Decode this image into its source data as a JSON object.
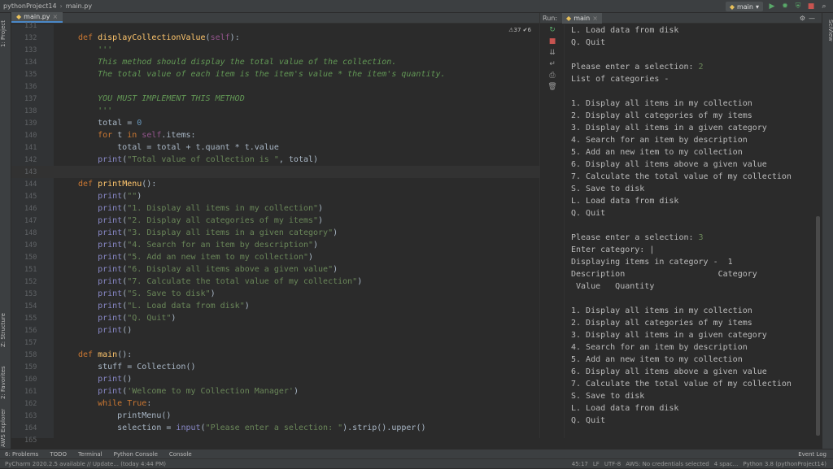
{
  "titlebar": {
    "project": "pythonProject14",
    "file": "main.py",
    "run_config": "main"
  },
  "editor": {
    "tab": "main.py",
    "inspection": "⚠37 ✔6",
    "lines": [
      {
        "n": "131",
        "html": ""
      },
      {
        "n": "132",
        "html": "<span class='kw'>def </span><span class='fn'>displayCollectionValue</span>(<span class='self'>self</span>):"
      },
      {
        "n": "133",
        "html": "    <span class='doc'>'''</span>"
      },
      {
        "n": "134",
        "html": "    <span class='doc'>This method should display the total value of the collection.</span>"
      },
      {
        "n": "135",
        "html": "    <span class='doc'>The total value of each item is the item's value * the item's quantity.</span>"
      },
      {
        "n": "136",
        "html": ""
      },
      {
        "n": "137",
        "html": "    <span class='doc'>YOU MUST IMPLEMENT THIS METHOD</span>"
      },
      {
        "n": "138",
        "html": "    <span class='doc'>'''</span>"
      },
      {
        "n": "139",
        "html": "    total = <span class='num'>0</span>"
      },
      {
        "n": "140",
        "html": "    <span class='kw'>for </span>t <span class='kw'>in </span><span class='self'>self</span>.items:"
      },
      {
        "n": "141",
        "html": "        total = total + t.quant * t.value"
      },
      {
        "n": "142",
        "html": "    <span class='bi'>print</span>(<span class='str'>\"Total value of collection is \"</span>, total)"
      },
      {
        "n": "143",
        "html": ""
      },
      {
        "n": "144",
        "html": "<span class='kw'>def </span><span class='fn'>printMenu</span>():"
      },
      {
        "n": "145",
        "html": "    <span class='bi'>print</span>(<span class='str'>\"\"</span>)"
      },
      {
        "n": "146",
        "html": "    <span class='bi'>print</span>(<span class='str'>\"1. Display all items in my collection\"</span>)"
      },
      {
        "n": "147",
        "html": "    <span class='bi'>print</span>(<span class='str'>\"2. Display all categories of my items\"</span>)"
      },
      {
        "n": "148",
        "html": "    <span class='bi'>print</span>(<span class='str'>\"3. Display all items in a given category\"</span>)"
      },
      {
        "n": "149",
        "html": "    <span class='bi'>print</span>(<span class='str'>\"4. Search for an item by description\"</span>)"
      },
      {
        "n": "150",
        "html": "    <span class='bi'>print</span>(<span class='str'>\"5. Add an new item to my collection\"</span>)"
      },
      {
        "n": "151",
        "html": "    <span class='bi'>print</span>(<span class='str'>\"6. Display all items above a given value\"</span>)"
      },
      {
        "n": "152",
        "html": "    <span class='bi'>print</span>(<span class='str'>\"7. Calculate the total value of my collection\"</span>)"
      },
      {
        "n": "153",
        "html": "    <span class='bi'>print</span>(<span class='str'>\"S. Save to disk\"</span>)"
      },
      {
        "n": "154",
        "html": "    <span class='bi'>print</span>(<span class='str'>\"L. Load data from disk\"</span>)"
      },
      {
        "n": "155",
        "html": "    <span class='bi'>print</span>(<span class='str'>\"Q. Quit\"</span>)"
      },
      {
        "n": "156",
        "html": "    <span class='bi'>print</span>()"
      },
      {
        "n": "157",
        "html": ""
      },
      {
        "n": "158",
        "html": "<span class='kw'>def </span><span class='fn'>main</span>():"
      },
      {
        "n": "159",
        "html": "    stuff = Collection()"
      },
      {
        "n": "160",
        "html": "    <span class='bi'>print</span>()"
      },
      {
        "n": "161",
        "html": "    <span class='bi'>print</span>(<span class='str'>'Welcome to my Collection Manager'</span>)"
      },
      {
        "n": "162",
        "html": "    <span class='kw'>while True</span>:"
      },
      {
        "n": "163",
        "html": "        printMenu()"
      },
      {
        "n": "164",
        "html": "        selection = <span class='bi'>input</span>(<span class='str'>\"Please enter a selection: \"</span>).strip().upper()"
      },
      {
        "n": "165",
        "html": ""
      }
    ]
  },
  "run": {
    "label": "Run:",
    "tab": "main",
    "console": [
      {
        "t": "L. Load data from disk"
      },
      {
        "t": "Q. Quit"
      },
      {
        "t": ""
      },
      {
        "t": "Please enter a selection: ",
        "in": "2"
      },
      {
        "t": "List of categories -"
      },
      {
        "t": ""
      },
      {
        "t": "1. Display all items in my collection"
      },
      {
        "t": "2. Display all categories of my items"
      },
      {
        "t": "3. Display all items in a given category"
      },
      {
        "t": "4. Search for an item by description"
      },
      {
        "t": "5. Add an new item to my collection"
      },
      {
        "t": "6. Display all items above a given value"
      },
      {
        "t": "7. Calculate the total value of my collection"
      },
      {
        "t": "S. Save to disk"
      },
      {
        "t": "L. Load data from disk"
      },
      {
        "t": "Q. Quit"
      },
      {
        "t": ""
      },
      {
        "t": "Please enter a selection: ",
        "in": "3"
      },
      {
        "t": "Enter category: |"
      },
      {
        "t": "Displaying items in category -  1"
      },
      {
        "t": "Description                   Category"
      },
      {
        "t": " Value   Quantity"
      },
      {
        "t": ""
      },
      {
        "t": "1. Display all items in my collection"
      },
      {
        "t": "2. Display all categories of my items"
      },
      {
        "t": "3. Display all items in a given category"
      },
      {
        "t": "4. Search for an item by description"
      },
      {
        "t": "5. Add an new item to my collection"
      },
      {
        "t": "6. Display all items above a given value"
      },
      {
        "t": "7. Calculate the total value of my collection"
      },
      {
        "t": "S. Save to disk"
      },
      {
        "t": "L. Load data from disk"
      },
      {
        "t": "Q. Quit"
      },
      {
        "t": ""
      },
      {
        "t": "Please enter a selection:"
      }
    ]
  },
  "left_tabs": [
    "1: Project",
    "Z: Structure",
    "2: Favorites",
    "AWS Explorer"
  ],
  "right_tabs": [
    "SciView"
  ],
  "bottom_tabs": [
    "6: Problems",
    "TODO",
    "Terminal",
    "Python Console",
    "Console"
  ],
  "event_log": "Event Log",
  "status": {
    "message": "PyCharm 2020.2.5 available // Update... (today 4:44 PM)",
    "right": [
      "45:17",
      "LF",
      "UTF-8",
      "AWS: No credentials selected",
      "4 spac...",
      "Python 3.8 (pythonProject14)"
    ]
  }
}
